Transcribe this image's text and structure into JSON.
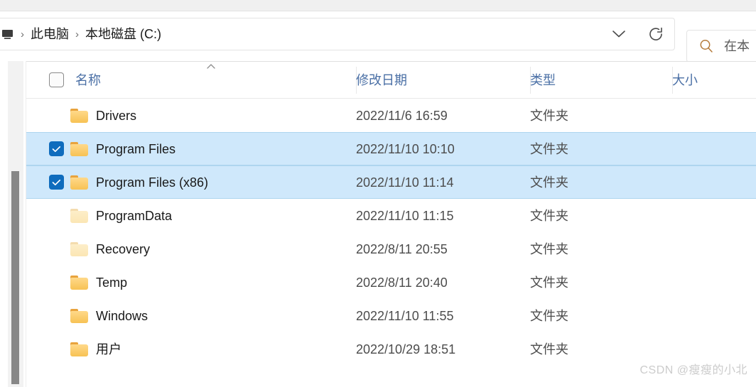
{
  "window": {
    "top_strip_color": "#f0f0f0"
  },
  "address_bar": {
    "pc_icon": "this-pc-icon",
    "separator": "›",
    "crumbs": [
      {
        "label": "此电脑"
      },
      {
        "label": "本地磁盘 (C:)"
      }
    ],
    "dropdown_icon": "chevron-down-icon",
    "refresh_icon": "refresh-icon"
  },
  "search": {
    "icon": "search-icon",
    "placeholder": "在 本地磁盘 (C:) 中搜索",
    "visible_text": "在本"
  },
  "columns": {
    "select_all_checked": false,
    "sort_icon": "chevron-up-icon",
    "sort_column": "名称",
    "sort_direction": "ascending",
    "headers": [
      {
        "label": "名称",
        "key": "name"
      },
      {
        "label": "修改日期",
        "key": "date"
      },
      {
        "label": "类型",
        "key": "type"
      },
      {
        "label": "大小",
        "key": "size"
      }
    ]
  },
  "files": [
    {
      "name": "Drivers",
      "date": "2022/11/6 16:59",
      "type": "文件夹",
      "size": "",
      "selected": false,
      "dim": false
    },
    {
      "name": "Program Files",
      "date": "2022/11/10 10:10",
      "type": "文件夹",
      "size": "",
      "selected": true,
      "dim": false
    },
    {
      "name": "Program Files (x86)",
      "date": "2022/11/10 11:14",
      "type": "文件夹",
      "size": "",
      "selected": true,
      "dim": false
    },
    {
      "name": "ProgramData",
      "date": "2022/11/10 11:15",
      "type": "文件夹",
      "size": "",
      "selected": false,
      "dim": true
    },
    {
      "name": "Recovery",
      "date": "2022/8/11 20:55",
      "type": "文件夹",
      "size": "",
      "selected": false,
      "dim": true
    },
    {
      "name": "Temp",
      "date": "2022/8/11 20:40",
      "type": "文件夹",
      "size": "",
      "selected": false,
      "dim": false
    },
    {
      "name": "Windows",
      "date": "2022/11/10 11:55",
      "type": "文件夹",
      "size": "",
      "selected": false,
      "dim": false
    },
    {
      "name": "用户",
      "date": "2022/10/29 18:51",
      "type": "文件夹",
      "size": "",
      "selected": false,
      "dim": false
    }
  ],
  "scrollbar": {
    "orientation": "vertical",
    "position": "left"
  },
  "watermark": {
    "text": "CSDN @瘦瘦的小北"
  },
  "colors": {
    "selection_fill": "#cfe8fb",
    "selection_border": "#aed5ef",
    "checkbox_blue": "#0f6cbd",
    "header_text": "#4a6fa5",
    "folder_yellow": "#f7c254"
  }
}
